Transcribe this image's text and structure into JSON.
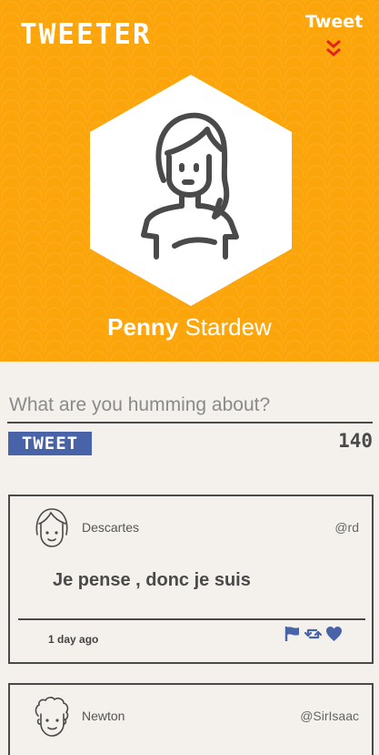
{
  "header": {
    "logo": "TWEETER",
    "tweet_link": "Tweet",
    "chevron_icon": "double-chevron-down-icon",
    "chevron_color": "#e4231a",
    "background_color": "#fca50a"
  },
  "profile": {
    "first_name": "Penny",
    "last_name": "Stardew"
  },
  "compose": {
    "placeholder": "What are you humming about?",
    "value": "",
    "button_label": "TWEET",
    "counter": "140",
    "button_color": "#4863a8"
  },
  "tweets": [
    {
      "username": "Descartes",
      "handle": "@rd",
      "content": "Je pense , donc je suis",
      "time": "1 day ago",
      "actions": [
        "flag-icon",
        "retweet-icon",
        "heart-icon"
      ]
    },
    {
      "username": "Newton",
      "handle": "@SirIsaac"
    }
  ]
}
